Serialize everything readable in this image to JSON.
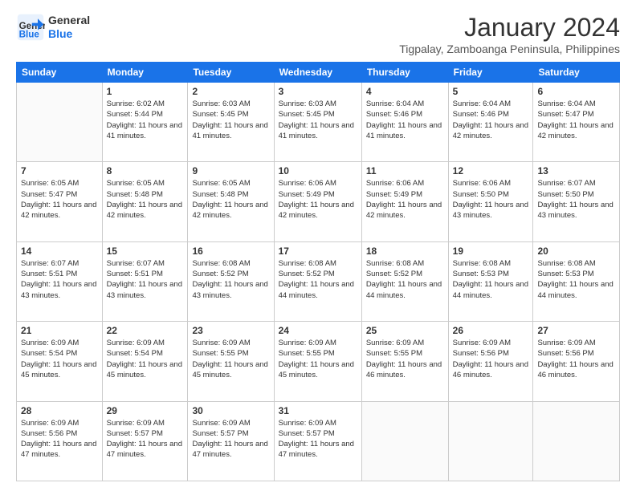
{
  "header": {
    "logo_line1": "General",
    "logo_line2": "Blue",
    "month": "January 2024",
    "location": "Tigpalay, Zamboanga Peninsula, Philippines"
  },
  "weekdays": [
    "Sunday",
    "Monday",
    "Tuesday",
    "Wednesday",
    "Thursday",
    "Friday",
    "Saturday"
  ],
  "weeks": [
    [
      {
        "day": "",
        "sunrise": "",
        "sunset": "",
        "daylight": ""
      },
      {
        "day": "1",
        "sunrise": "Sunrise: 6:02 AM",
        "sunset": "Sunset: 5:44 PM",
        "daylight": "Daylight: 11 hours and 41 minutes."
      },
      {
        "day": "2",
        "sunrise": "Sunrise: 6:03 AM",
        "sunset": "Sunset: 5:45 PM",
        "daylight": "Daylight: 11 hours and 41 minutes."
      },
      {
        "day": "3",
        "sunrise": "Sunrise: 6:03 AM",
        "sunset": "Sunset: 5:45 PM",
        "daylight": "Daylight: 11 hours and 41 minutes."
      },
      {
        "day": "4",
        "sunrise": "Sunrise: 6:04 AM",
        "sunset": "Sunset: 5:46 PM",
        "daylight": "Daylight: 11 hours and 41 minutes."
      },
      {
        "day": "5",
        "sunrise": "Sunrise: 6:04 AM",
        "sunset": "Sunset: 5:46 PM",
        "daylight": "Daylight: 11 hours and 42 minutes."
      },
      {
        "day": "6",
        "sunrise": "Sunrise: 6:04 AM",
        "sunset": "Sunset: 5:47 PM",
        "daylight": "Daylight: 11 hours and 42 minutes."
      }
    ],
    [
      {
        "day": "7",
        "sunrise": "Sunrise: 6:05 AM",
        "sunset": "Sunset: 5:47 PM",
        "daylight": "Daylight: 11 hours and 42 minutes."
      },
      {
        "day": "8",
        "sunrise": "Sunrise: 6:05 AM",
        "sunset": "Sunset: 5:48 PM",
        "daylight": "Daylight: 11 hours and 42 minutes."
      },
      {
        "day": "9",
        "sunrise": "Sunrise: 6:05 AM",
        "sunset": "Sunset: 5:48 PM",
        "daylight": "Daylight: 11 hours and 42 minutes."
      },
      {
        "day": "10",
        "sunrise": "Sunrise: 6:06 AM",
        "sunset": "Sunset: 5:49 PM",
        "daylight": "Daylight: 11 hours and 42 minutes."
      },
      {
        "day": "11",
        "sunrise": "Sunrise: 6:06 AM",
        "sunset": "Sunset: 5:49 PM",
        "daylight": "Daylight: 11 hours and 42 minutes."
      },
      {
        "day": "12",
        "sunrise": "Sunrise: 6:06 AM",
        "sunset": "Sunset: 5:50 PM",
        "daylight": "Daylight: 11 hours and 43 minutes."
      },
      {
        "day": "13",
        "sunrise": "Sunrise: 6:07 AM",
        "sunset": "Sunset: 5:50 PM",
        "daylight": "Daylight: 11 hours and 43 minutes."
      }
    ],
    [
      {
        "day": "14",
        "sunrise": "Sunrise: 6:07 AM",
        "sunset": "Sunset: 5:51 PM",
        "daylight": "Daylight: 11 hours and 43 minutes."
      },
      {
        "day": "15",
        "sunrise": "Sunrise: 6:07 AM",
        "sunset": "Sunset: 5:51 PM",
        "daylight": "Daylight: 11 hours and 43 minutes."
      },
      {
        "day": "16",
        "sunrise": "Sunrise: 6:08 AM",
        "sunset": "Sunset: 5:52 PM",
        "daylight": "Daylight: 11 hours and 43 minutes."
      },
      {
        "day": "17",
        "sunrise": "Sunrise: 6:08 AM",
        "sunset": "Sunset: 5:52 PM",
        "daylight": "Daylight: 11 hours and 44 minutes."
      },
      {
        "day": "18",
        "sunrise": "Sunrise: 6:08 AM",
        "sunset": "Sunset: 5:52 PM",
        "daylight": "Daylight: 11 hours and 44 minutes."
      },
      {
        "day": "19",
        "sunrise": "Sunrise: 6:08 AM",
        "sunset": "Sunset: 5:53 PM",
        "daylight": "Daylight: 11 hours and 44 minutes."
      },
      {
        "day": "20",
        "sunrise": "Sunrise: 6:08 AM",
        "sunset": "Sunset: 5:53 PM",
        "daylight": "Daylight: 11 hours and 44 minutes."
      }
    ],
    [
      {
        "day": "21",
        "sunrise": "Sunrise: 6:09 AM",
        "sunset": "Sunset: 5:54 PM",
        "daylight": "Daylight: 11 hours and 45 minutes."
      },
      {
        "day": "22",
        "sunrise": "Sunrise: 6:09 AM",
        "sunset": "Sunset: 5:54 PM",
        "daylight": "Daylight: 11 hours and 45 minutes."
      },
      {
        "day": "23",
        "sunrise": "Sunrise: 6:09 AM",
        "sunset": "Sunset: 5:55 PM",
        "daylight": "Daylight: 11 hours and 45 minutes."
      },
      {
        "day": "24",
        "sunrise": "Sunrise: 6:09 AM",
        "sunset": "Sunset: 5:55 PM",
        "daylight": "Daylight: 11 hours and 45 minutes."
      },
      {
        "day": "25",
        "sunrise": "Sunrise: 6:09 AM",
        "sunset": "Sunset: 5:55 PM",
        "daylight": "Daylight: 11 hours and 46 minutes."
      },
      {
        "day": "26",
        "sunrise": "Sunrise: 6:09 AM",
        "sunset": "Sunset: 5:56 PM",
        "daylight": "Daylight: 11 hours and 46 minutes."
      },
      {
        "day": "27",
        "sunrise": "Sunrise: 6:09 AM",
        "sunset": "Sunset: 5:56 PM",
        "daylight": "Daylight: 11 hours and 46 minutes."
      }
    ],
    [
      {
        "day": "28",
        "sunrise": "Sunrise: 6:09 AM",
        "sunset": "Sunset: 5:56 PM",
        "daylight": "Daylight: 11 hours and 47 minutes."
      },
      {
        "day": "29",
        "sunrise": "Sunrise: 6:09 AM",
        "sunset": "Sunset: 5:57 PM",
        "daylight": "Daylight: 11 hours and 47 minutes."
      },
      {
        "day": "30",
        "sunrise": "Sunrise: 6:09 AM",
        "sunset": "Sunset: 5:57 PM",
        "daylight": "Daylight: 11 hours and 47 minutes."
      },
      {
        "day": "31",
        "sunrise": "Sunrise: 6:09 AM",
        "sunset": "Sunset: 5:57 PM",
        "daylight": "Daylight: 11 hours and 47 minutes."
      },
      {
        "day": "",
        "sunrise": "",
        "sunset": "",
        "daylight": ""
      },
      {
        "day": "",
        "sunrise": "",
        "sunset": "",
        "daylight": ""
      },
      {
        "day": "",
        "sunrise": "",
        "sunset": "",
        "daylight": ""
      }
    ]
  ]
}
